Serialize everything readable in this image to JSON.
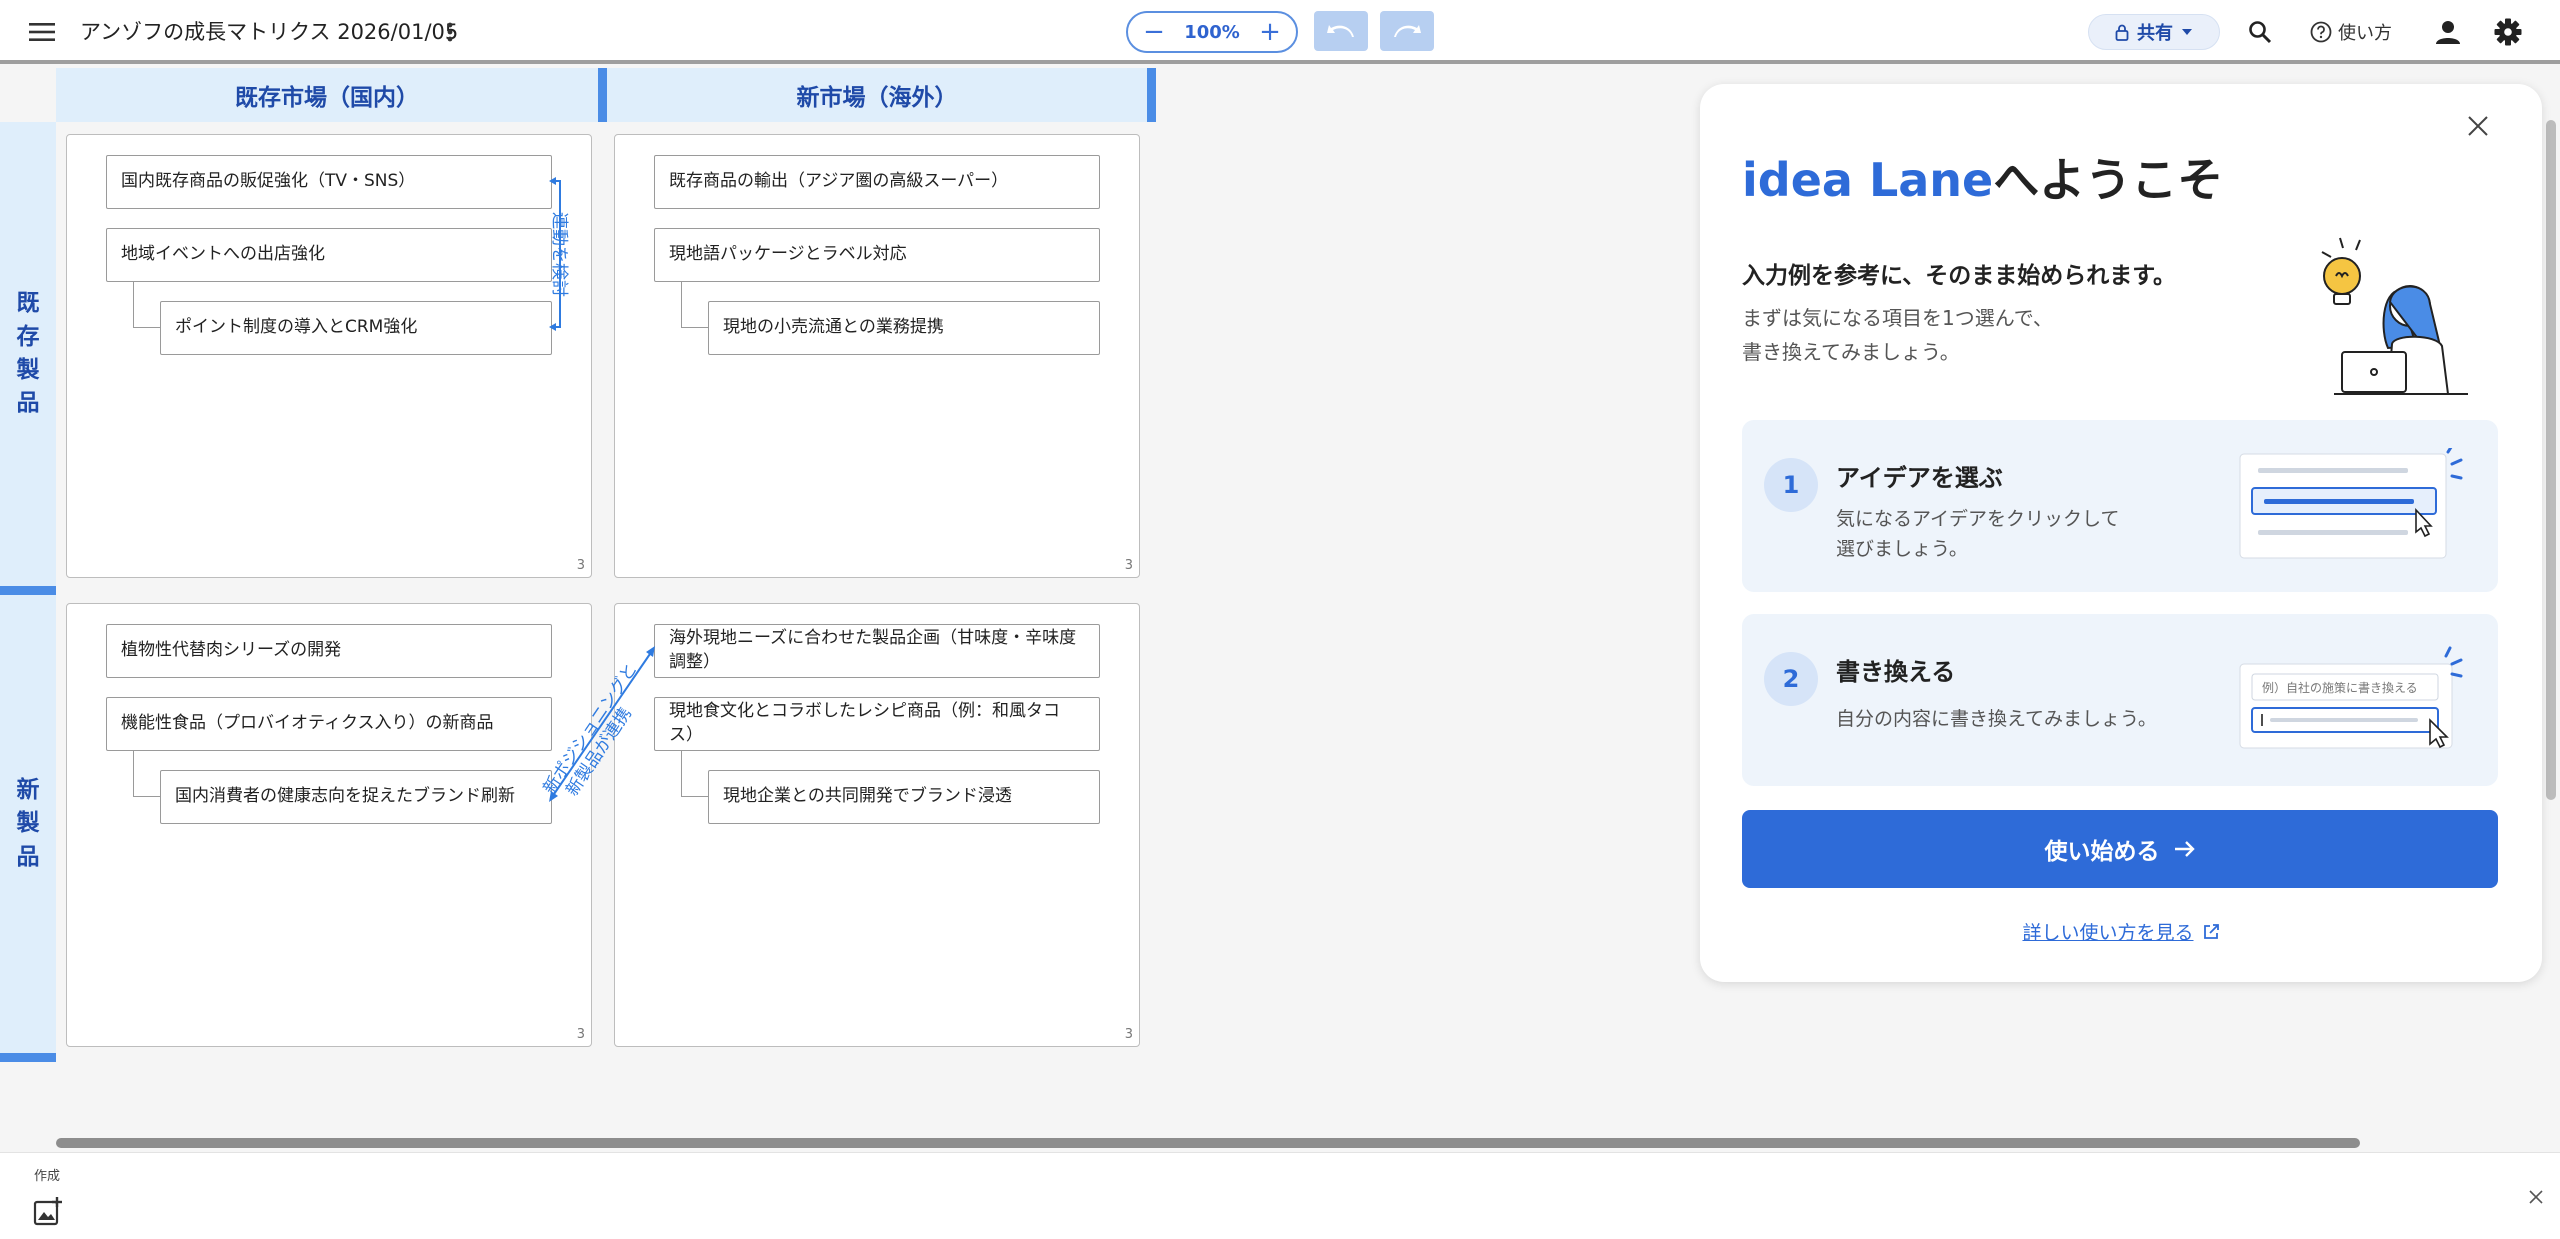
{
  "toolbar": {
    "title": "アンゾフの成長マトリクス 2026/01/05",
    "zoom": "100%",
    "zoom_out": "−",
    "zoom_in": "+",
    "share_label": "共有",
    "help_label": "使い方"
  },
  "matrix": {
    "columns": [
      "既存市場（国内）",
      "新市場（海外）"
    ],
    "rows": [
      [
        "既",
        "存",
        "製",
        "品"
      ],
      [
        "新",
        "製",
        "品"
      ]
    ],
    "quadrants": [
      {
        "count": "3",
        "cards": [
          "国内既存商品の販促強化（TV・SNS）",
          "地域イベントへの出店強化",
          "ポイント制度の導入とCRM強化"
        ]
      },
      {
        "count": "3",
        "cards": [
          "既存商品の輸出（アジア圏の高級スーパー）",
          "現地語パッケージとラベル対応",
          "現地の小売流通との業務提携"
        ]
      },
      {
        "count": "3",
        "cards": [
          "植物性代替肉シリーズの開発",
          "機能性食品（プロバイオティクス入り）の新商品",
          "国内消費者の健康志向を捉えたブランド刷新"
        ]
      },
      {
        "count": "3",
        "cards": [
          "海外現地ニーズに合わせた製品企画（甘味度・辛味度調整）",
          "現地食文化とコラボしたレシピ商品（例：和風タコス）",
          "現地企業との共同開発でブランド浸透"
        ]
      }
    ],
    "links": {
      "vertical": "連動を検討",
      "diagonal_1": "新ポジショニングと",
      "diagonal_2": "新製品が連携"
    }
  },
  "bottom": {
    "create_label": "作成"
  },
  "welcome": {
    "title_brand": "idea Lane",
    "title_rest": "へようこそ",
    "subtitle": "入力例を参考に、そのまま始められます。",
    "desc_line1": "まずは気になる項目を1つ選んで、",
    "desc_line2": "書き換えてみましょう。",
    "steps": [
      {
        "number": "1",
        "title": "アイデアを選ぶ",
        "desc_line1": "気になるアイデアをクリックして",
        "desc_line2": "選びましょう。"
      },
      {
        "number": "2",
        "title": "書き換える",
        "desc_line1": "自分の内容に書き換えてみましょう。",
        "example": "例）自社の施策に書き換える"
      }
    ],
    "start_button": "使い始める",
    "guide_link": "詳しい使い方を見る"
  },
  "colors": {
    "accent": "#2e6bd8",
    "header_bg": "#dfeefb",
    "header_bar": "#4a8ce6",
    "link": "#2f7be0"
  }
}
